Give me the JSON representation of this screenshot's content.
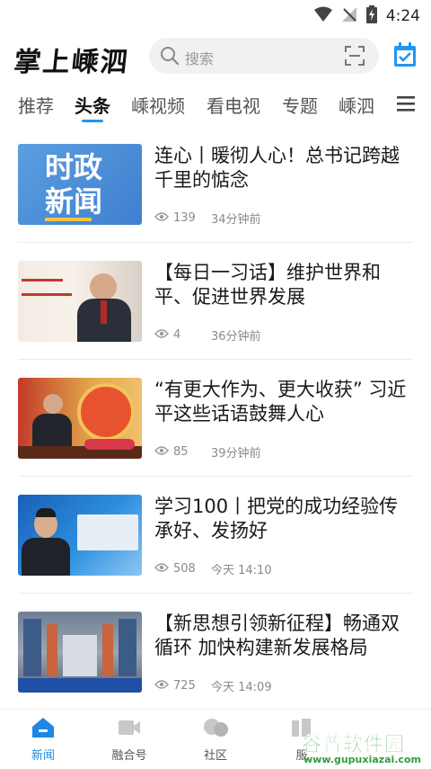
{
  "status": {
    "time": "4:24"
  },
  "header": {
    "logo": "掌上嵊泗",
    "search_placeholder": "搜索"
  },
  "tabs": [
    {
      "label": "推荐"
    },
    {
      "label": "头条"
    },
    {
      "label": "嵊视频"
    },
    {
      "label": "看电视"
    },
    {
      "label": "专题"
    },
    {
      "label": "嵊泗"
    }
  ],
  "active_tab": "头条",
  "news": [
    {
      "title": "连心丨暖彻人心！总书记跨越千里的惦念",
      "views": "139",
      "time": "34分钟前",
      "thumb_text": [
        "时政",
        "新闻"
      ]
    },
    {
      "title": "【每日一习话】维护世界和平、促进世界发展",
      "views": "4",
      "time": "36分钟前"
    },
    {
      "title": "“有更大作为、更大收获” 习近平这些话语鼓舞人心",
      "views": "85",
      "time": "39分钟前"
    },
    {
      "title": "学习100丨把党的成功经验传承好、发扬好",
      "views": "508",
      "time": "今天 14:10"
    },
    {
      "title": "【新思想引领新征程】畅通双循环 加快构建新发展格局",
      "views": "725",
      "time": "今天 14:09"
    }
  ],
  "bottom_nav": [
    {
      "label": "新闻"
    },
    {
      "label": "融合号"
    },
    {
      "label": "社区"
    },
    {
      "label": "服"
    }
  ],
  "watermark": {
    "text": "谷普软件园",
    "url": "www.gupuxiazai.com"
  },
  "colors": {
    "accent": "#1e88e5",
    "tab_underline": "#2196f3",
    "watermark": "#2e9e3e"
  }
}
